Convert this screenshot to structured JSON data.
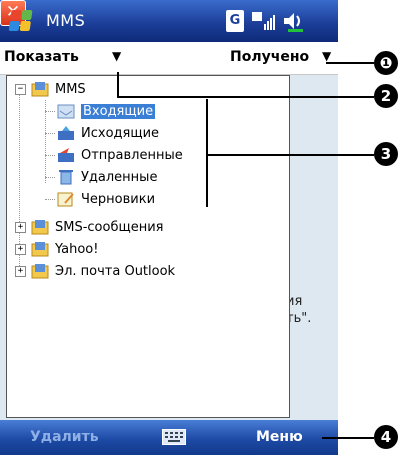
{
  "titlebar": {
    "app_title": "MMS",
    "connectivity_badge": "G",
    "close_glyph": "✕"
  },
  "filterbar": {
    "show_label": "Показать",
    "sort_label": "Получено",
    "arrow": "▼"
  },
  "tree": {
    "root": {
      "label": "MMS",
      "expander": "−"
    },
    "folders": [
      {
        "label": "Входящие",
        "icon": "inbox-icon",
        "selected": true
      },
      {
        "label": "Исходящие",
        "icon": "outbox-icon"
      },
      {
        "label": "Отправленные",
        "icon": "sent-icon"
      },
      {
        "label": "Удаленные",
        "icon": "deleted-icon"
      },
      {
        "label": "Черновики",
        "icon": "drafts-icon"
      }
    ],
    "accounts": [
      {
        "label": "SMS-сообщения",
        "expander": "+"
      },
      {
        "label": "Yahoo!",
        "expander": "+"
      },
      {
        "label": "Эл. почта Outlook",
        "expander": "+"
      }
    ]
  },
  "background_text": [
    "ия",
    "ть\"."
  ],
  "softkeys": {
    "left": "Удалить",
    "right": "Меню"
  },
  "callouts": [
    "❶",
    "2",
    "3",
    "4"
  ],
  "colors": {
    "titlebar": "#1c3f9a",
    "selection": "#3a7fd6",
    "softkey_disabled": "#8fb0e6"
  }
}
